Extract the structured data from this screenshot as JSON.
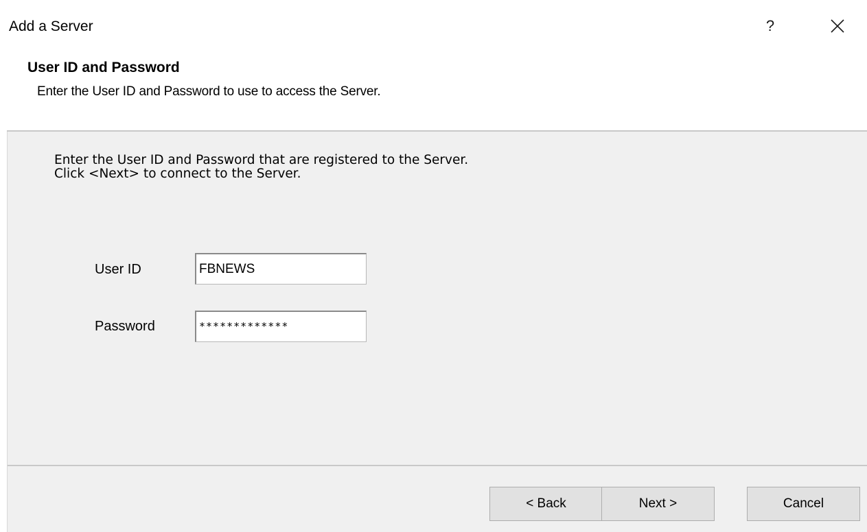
{
  "window": {
    "title": "Add a Server",
    "help_label": "?",
    "close_icon": "close-icon"
  },
  "header": {
    "title": "User ID and Password",
    "subtitle": "Enter the User ID and Password to use to access the Server."
  },
  "instructions": {
    "line1": "Enter the User ID and Password that are registered to the Server.",
    "line2": "Click <Next> to connect to the Server."
  },
  "form": {
    "user_id_label": "User ID",
    "user_id_value": "FBNEWS",
    "password_label": "Password",
    "password_value": "*************"
  },
  "buttons": {
    "back": "< Back",
    "next": "Next >",
    "cancel": "Cancel"
  },
  "colors": {
    "body_bg": "#f0f0f0",
    "header_bg": "#ffffff",
    "button_bg": "#e1e1e1"
  }
}
